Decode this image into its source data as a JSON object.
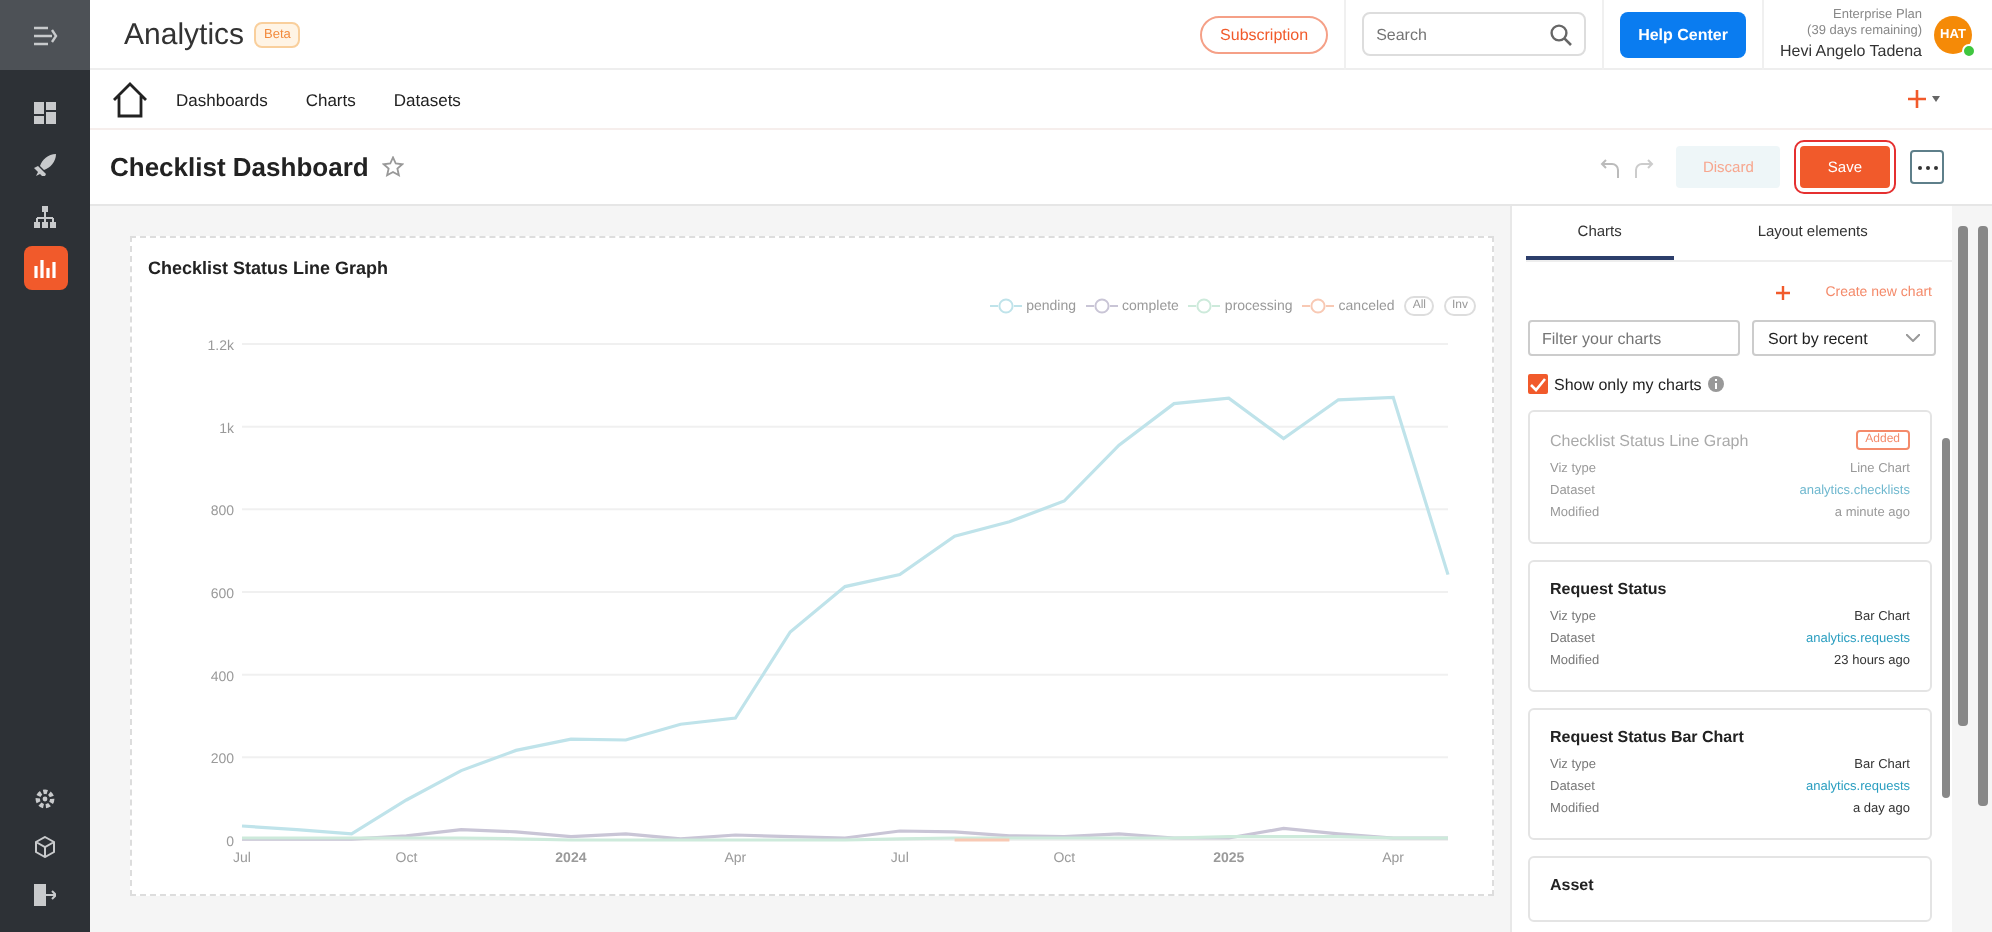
{
  "sidebar": {
    "items": [
      {
        "selected": false
      },
      {
        "selected": false
      },
      {
        "selected": false
      },
      {
        "selected": true
      }
    ]
  },
  "header": {
    "app_name": "Analytics",
    "badge": "Beta",
    "subscription_button": "Subscription",
    "search": {
      "placeholder": "Search"
    },
    "help_button": "Help Center",
    "user": {
      "plan": "Enterprise Plan",
      "plan_note": "(39 days remaining)",
      "name": "Hevi Angelo Tadena",
      "initials": "HAT"
    }
  },
  "nav": {
    "items": [
      "Dashboards",
      "Charts",
      "Datasets"
    ]
  },
  "title_bar": {
    "title": "Checklist Dashboard",
    "discard_button": "Discard",
    "save_button": "Save"
  },
  "chart_card": {
    "title": "Checklist Status Line Graph",
    "legend_buttons": [
      "All",
      "Inv"
    ],
    "chart_data": {
      "type": "line",
      "x": [
        "2023-07",
        "2023-08",
        "2023-09",
        "2023-10",
        "2023-11",
        "2023-12",
        "2024-01",
        "2024-02",
        "2024-03",
        "2024-04",
        "2024-05",
        "2024-06",
        "2024-07",
        "2024-08",
        "2024-09",
        "2024-10",
        "2024-11",
        "2024-12",
        "2025-01",
        "2025-02",
        "2025-03",
        "2025-04",
        "2025-05"
      ],
      "series": [
        {
          "name": "pending",
          "color": "#bfe3ea",
          "values": [
            34,
            25,
            15,
            97,
            168,
            217,
            244,
            242,
            280,
            295,
            503,
            613,
            642,
            735,
            770,
            820,
            955,
            1056,
            1069,
            971,
            1065,
            1071,
            642
          ]
        },
        {
          "name": "complete",
          "color": "#c9c5d6",
          "values": [
            2,
            2,
            2,
            10,
            25,
            20,
            8,
            15,
            3,
            12,
            8,
            5,
            22,
            20,
            10,
            8,
            15,
            5,
            5,
            28,
            15,
            5,
            5
          ]
        },
        {
          "name": "processing",
          "color": "#cdeadb",
          "values": [
            5,
            5,
            5,
            5,
            5,
            3,
            0,
            0,
            0,
            0,
            0,
            0,
            3,
            5,
            5,
            5,
            5,
            5,
            8,
            8,
            8,
            5,
            5
          ]
        },
        {
          "name": "canceled",
          "color": "#f8c9b4",
          "values": [
            null,
            null,
            null,
            null,
            null,
            null,
            null,
            null,
            null,
            null,
            null,
            null,
            null,
            0,
            0,
            null,
            null,
            null,
            null,
            null,
            null,
            null,
            null
          ]
        }
      ],
      "ylim": [
        0,
        1200
      ],
      "xlim": [
        "2023-07",
        "2025-05"
      ],
      "grid": true,
      "yticks": [
        0,
        200,
        400,
        600,
        800,
        {
          "value": 1000,
          "label": "1k"
        },
        {
          "value": 1200,
          "label": "1.2k"
        }
      ],
      "xticks": [
        {
          "value": "2023-07",
          "label": "Jul"
        },
        {
          "value": "2023-10",
          "label": "Oct"
        },
        {
          "value": "2024-01",
          "label": "2024"
        },
        {
          "value": "2024-04",
          "label": "Apr"
        },
        {
          "value": "2024-07",
          "label": "Jul"
        },
        {
          "value": "2024-10",
          "label": "Oct"
        },
        {
          "value": "2025-01",
          "label": "2025"
        },
        {
          "value": "2025-04",
          "label": "Apr"
        }
      ]
    }
  },
  "panel": {
    "tabs": [
      {
        "label": "Charts",
        "selected": true
      },
      {
        "label": "Layout elements",
        "selected": false
      }
    ],
    "create_link": "Create new chart",
    "filter": {
      "placeholder": "Filter your charts"
    },
    "sort": {
      "value": "Sort by recent"
    },
    "show_only_mine": {
      "label": "Show only my charts",
      "checked": true
    },
    "cards": [
      {
        "title": "Checklist Status Line Graph",
        "added": true,
        "badge": "Added",
        "rows": [
          {
            "label": "Viz type",
            "value": "Line Chart",
            "kind": "text"
          },
          {
            "label": "Dataset",
            "value": "analytics.checklists",
            "kind": "link"
          },
          {
            "label": "Modified",
            "value": "a minute ago",
            "kind": "text"
          }
        ]
      },
      {
        "title": "Request Status",
        "added": false,
        "rows": [
          {
            "label": "Viz type",
            "value": "Bar Chart",
            "kind": "text"
          },
          {
            "label": "Dataset",
            "value": "analytics.requests",
            "kind": "link"
          },
          {
            "label": "Modified",
            "value": "23 hours ago",
            "kind": "text"
          }
        ]
      },
      {
        "title": "Request Status Bar Chart",
        "added": false,
        "rows": [
          {
            "label": "Viz type",
            "value": "Bar Chart",
            "kind": "text"
          },
          {
            "label": "Dataset",
            "value": "analytics.requests",
            "kind": "link"
          },
          {
            "label": "Modified",
            "value": "a day ago",
            "kind": "text"
          }
        ]
      },
      {
        "title": "Asset",
        "added": false
      }
    ]
  }
}
